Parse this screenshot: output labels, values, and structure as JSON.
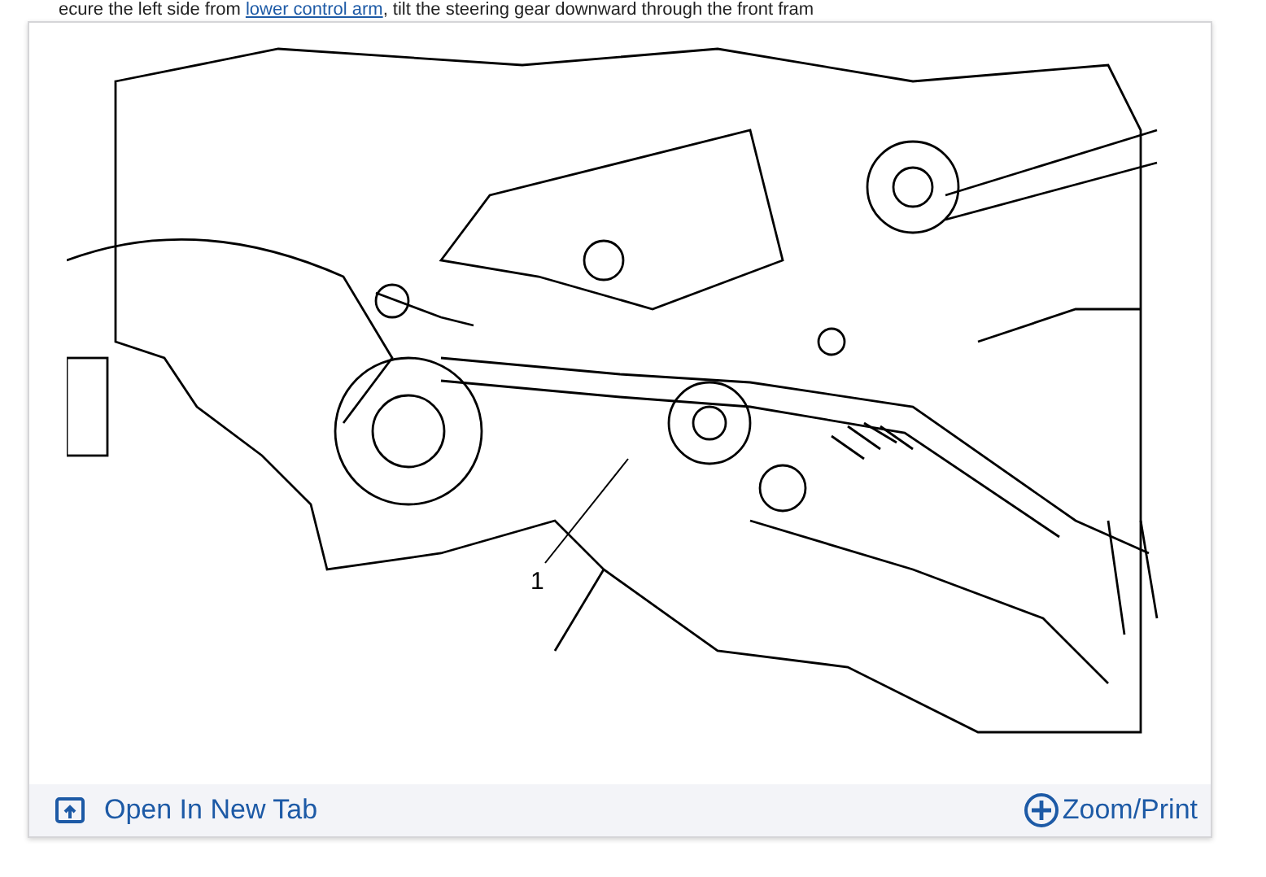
{
  "intro": {
    "before": "ecure the left side from ",
    "link": "lower control arm",
    "after": ", tilt the steering gear downward through the front fram"
  },
  "figure": {
    "callouts": [
      {
        "label": "1"
      }
    ],
    "footer": {
      "open_link": "Open In New Tab",
      "zoom_link": "Zoom/Print"
    }
  }
}
